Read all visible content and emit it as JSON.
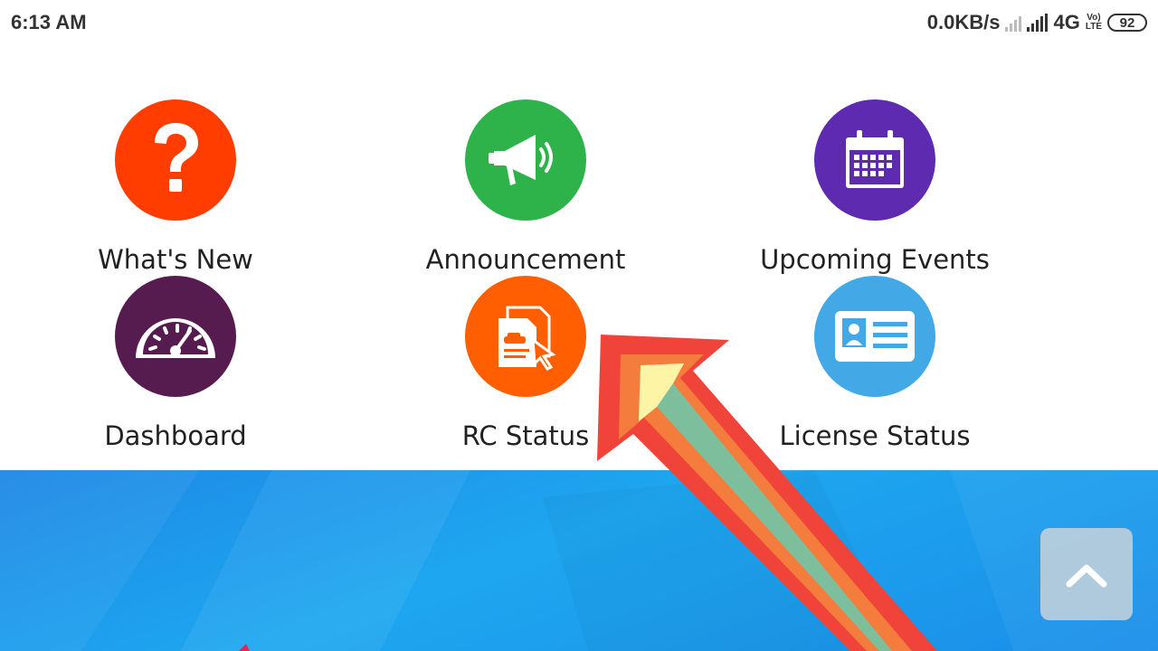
{
  "status": {
    "time": "6:13 AM",
    "speed": "0.0KB/s",
    "network": "4G",
    "volte_top": "Vo)",
    "volte_bottom": "LTE",
    "battery": "92"
  },
  "menu": {
    "items": [
      {
        "label": "What's New",
        "icon": "question-icon",
        "color": "#ff3d00"
      },
      {
        "label": "Announcement",
        "icon": "megaphone-icon",
        "color": "#2db34a"
      },
      {
        "label": "Upcoming Events",
        "icon": "calendar-icon",
        "color": "#5e2ab0"
      },
      {
        "label": "Dashboard",
        "icon": "speedometer-icon",
        "color": "#561c4f"
      },
      {
        "label": "RC Status",
        "icon": "rc-document-icon",
        "color": "#ff5f00"
      },
      {
        "label": "License Status",
        "icon": "id-card-icon",
        "color": "#42a8e6"
      }
    ]
  },
  "scroll_top": {
    "icon": "chevron-up-icon"
  },
  "colors": {
    "banner": "#1e8fe6",
    "arrow_outer": "#f0443a",
    "arrow_mid": "#f47c3c",
    "arrow_inner": "#7dbf9c"
  }
}
